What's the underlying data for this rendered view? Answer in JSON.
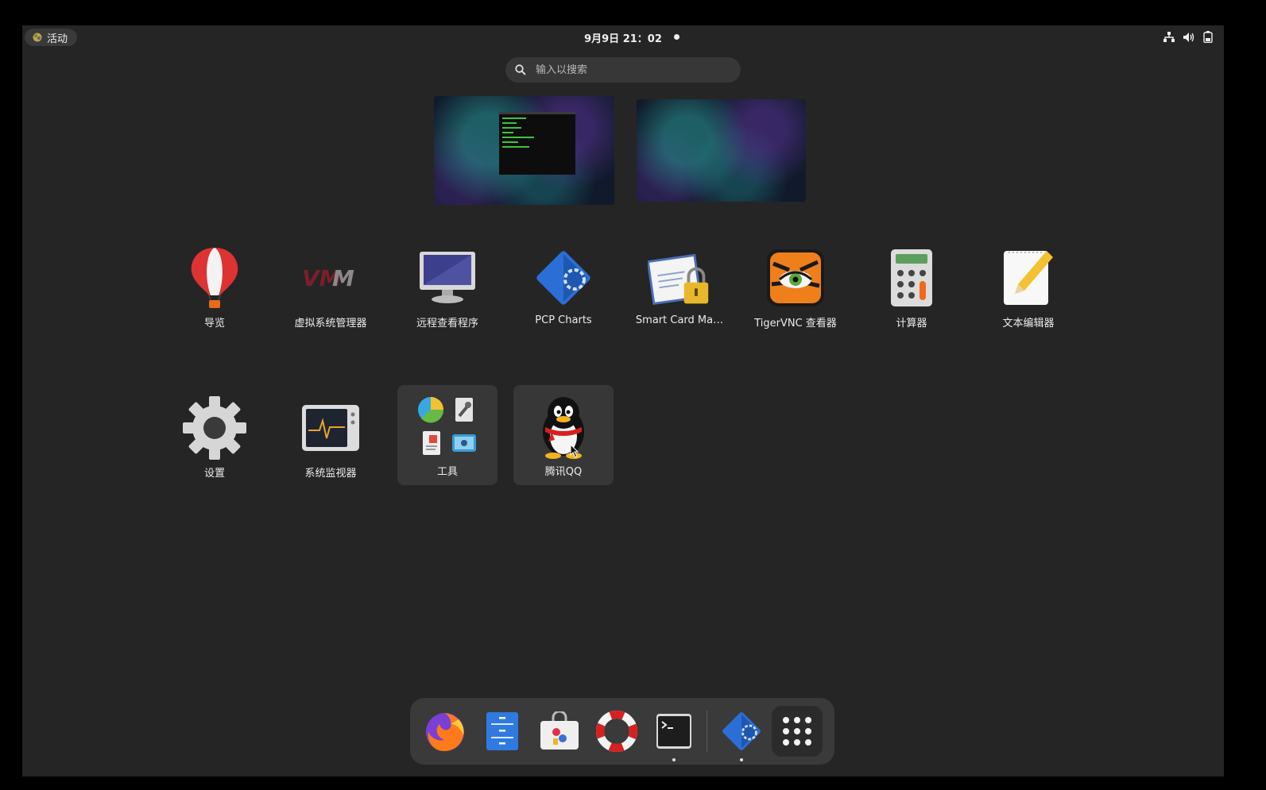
{
  "topbar": {
    "activities_label": "活动",
    "clock": "9月9日 21：02",
    "tray_icons": [
      "network-icon",
      "volume-icon",
      "battery-icon"
    ]
  },
  "search": {
    "placeholder": "输入以搜索"
  },
  "workspaces": [
    {
      "name": "workspace-1",
      "has_window": "terminal"
    },
    {
      "name": "workspace-2",
      "has_window": "none"
    }
  ],
  "apps": [
    {
      "label": "导览",
      "icon": "balloon-icon"
    },
    {
      "label": "虚拟系统管理器",
      "icon": "vmm-icon"
    },
    {
      "label": "远程查看程序",
      "icon": "monitor-icon"
    },
    {
      "label": "PCP Charts",
      "icon": "pcp-charts-icon"
    },
    {
      "label": "Smart Card Ma…",
      "icon": "smartcard-lock-icon"
    },
    {
      "label": "TigerVNC 查看器",
      "icon": "tiger-icon"
    },
    {
      "label": "计算器",
      "icon": "calculator-icon"
    },
    {
      "label": "文本编辑器",
      "icon": "text-editor-icon"
    },
    {
      "label": "设置",
      "icon": "gear-icon"
    },
    {
      "label": "系统监视器",
      "icon": "system-monitor-icon"
    },
    {
      "label": "工具",
      "icon": "folder-icon"
    },
    {
      "label": "腾讯QQ",
      "icon": "qq-penguin-icon"
    }
  ],
  "dock": [
    {
      "name": "firefox",
      "icon": "firefox-icon",
      "running": false
    },
    {
      "name": "files",
      "icon": "files-icon",
      "running": false
    },
    {
      "name": "software",
      "icon": "software-icon",
      "running": false
    },
    {
      "name": "help",
      "icon": "lifebuoy-icon",
      "running": false
    },
    {
      "name": "terminal",
      "icon": "terminal-icon",
      "running": true
    },
    {
      "name": "pcp-charts",
      "icon": "pcp-charts-icon",
      "running": true
    },
    {
      "name": "show-apps",
      "icon": "app-grid-icon",
      "running": false
    }
  ]
}
